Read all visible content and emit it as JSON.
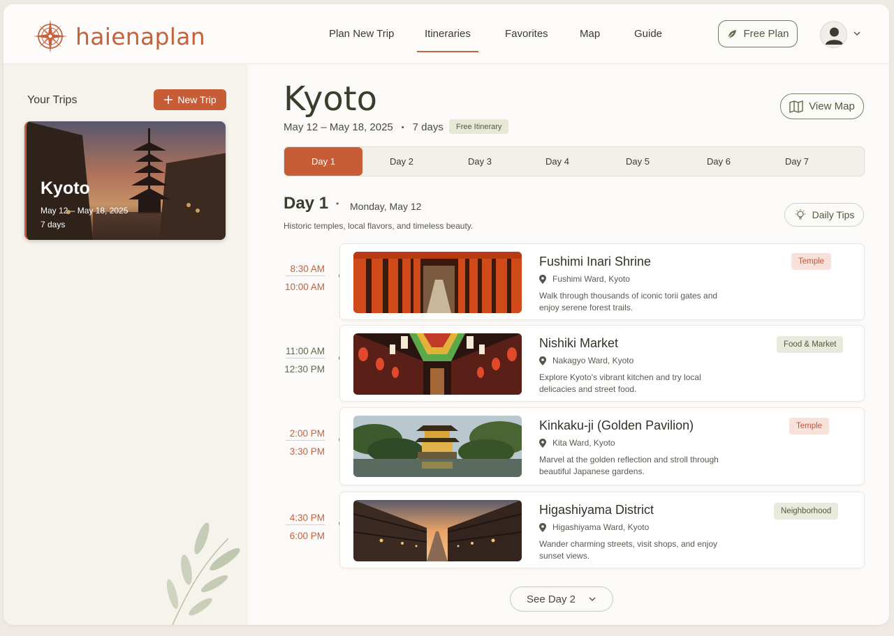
{
  "brand": {
    "name": "haienaplan",
    "logo_icon": "compass-icon",
    "accent": "#c4623c"
  },
  "nav": {
    "items": [
      "Plan New Trip",
      "Itineraries",
      "Favorites",
      "Map",
      "Guide"
    ],
    "active": "Itineraries"
  },
  "header": {
    "free_plan_label": "Free Plan"
  },
  "sidebar": {
    "title": "Your Trips",
    "new_trip_label": "New Trip",
    "trip": {
      "name": "Kyoto",
      "dates": "May 12 – May 18, 2025",
      "days": "7 days"
    }
  },
  "main": {
    "city": "Kyoto",
    "dates": "May 12 – May 18, 2025",
    "separator": "•",
    "duration": "7 days",
    "free_badge": "Free Itinerary",
    "view_map_label": "View Map",
    "day_tabs": [
      "Day 1",
      "Day 2",
      "Day 3",
      "Day 4",
      "Day 5",
      "Day 6",
      "Day 7"
    ],
    "active_tab": "Day 1",
    "day_heading": "Day 1",
    "day_date": "Monday, May 12",
    "day_subtitle": "Historic temples, local flavors, and timeless beauty.",
    "daily_tips_label": "Daily Tips",
    "see_next_label": "See Day 2"
  },
  "activities": [
    {
      "start": "8:30 AM",
      "end": "10:00 AM",
      "title": "Fushimi Inari Shrine",
      "location": "Fushimi Ward, Kyoto",
      "description": "Walk through thousands of iconic torii gates and enjoy serene forest trails.",
      "tag": "Temple",
      "tag_color": "#f8e1da",
      "tag_text": "#b85a3c",
      "time_color": "#c4623c"
    },
    {
      "start": "11:00 AM",
      "end": "12:30 PM",
      "title": "Nishiki Market",
      "location": "Nakagyo Ward, Kyoto",
      "description": "Explore Kyoto's vibrant kitchen and try local delicacies and street food.",
      "tag": "Food & Market",
      "tag_color": "#e9eadc",
      "tag_text": "#4f5a40",
      "time_color": "#5d6a4a"
    },
    {
      "start": "2:00 PM",
      "end": "3:30 PM",
      "title": "Kinkaku-ji (Golden Pavilion)",
      "location": "Kita Ward, Kyoto",
      "description": "Marvel at the golden reflection and stroll through beautiful Japanese gardens.",
      "tag": "Temple",
      "tag_color": "#f8e1da",
      "tag_text": "#b85a3c",
      "time_color": "#c4623c"
    },
    {
      "start": "4:30 PM",
      "end": "6:00 PM",
      "title": "Higashiyama District",
      "location": "Higashiyama Ward, Kyoto",
      "description": "Wander charming streets, visit shops, and enjoy sunset views.",
      "tag": "Neighborhood",
      "tag_color": "#e9eadc",
      "tag_text": "#4f5a40",
      "time_color": "#c4623c"
    }
  ]
}
